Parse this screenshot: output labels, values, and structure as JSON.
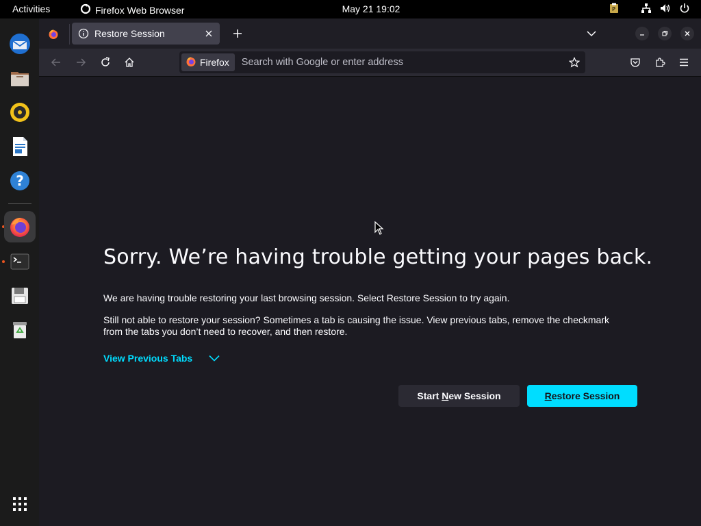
{
  "topbar": {
    "activities": "Activities",
    "app_name": "Firefox Web Browser",
    "clock": "May 21  19:02"
  },
  "dock": {
    "apps": [
      "thunderbird-icon",
      "files-icon",
      "rhythmbox-icon",
      "libreoffice-writer-icon",
      "help-icon",
      "firefox-icon",
      "terminal-icon",
      "save-icon",
      "trash-icon",
      "app-grid-icon"
    ]
  },
  "browser": {
    "tab": {
      "title": "Restore Session"
    },
    "urlbar": {
      "identity_label": "Firefox",
      "placeholder": "Search with Google or enter address"
    }
  },
  "page": {
    "heading": "Sorry. We’re having trouble getting your pages back.",
    "para1": "We are having trouble restoring your last browsing session. Select Restore Session to try again.",
    "para2": "Still not able to restore your session? Sometimes a tab is causing the issue. View previous tabs, remove the checkmark from the tabs you don’t need to recover, and then restore.",
    "view_previous_tabs": "View Previous Tabs",
    "start_new": {
      "pre": "Start ",
      "accesskey": "N",
      "post": "ew Session"
    },
    "restore": {
      "pre": "",
      "accesskey": "R",
      "post": "estore Session"
    }
  },
  "colors": {
    "accent": "#00ddff",
    "background": "#1c1b22",
    "toolbar": "#2b2a33",
    "ubuntu_orange": "#e95420"
  }
}
